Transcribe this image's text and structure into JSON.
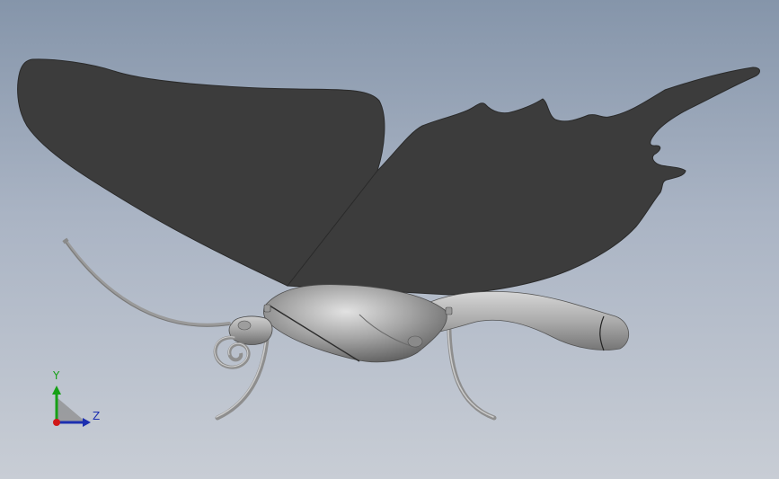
{
  "viewport": {
    "background_top": "#8595aa",
    "background_bottom": "#c8cdd5"
  },
  "model": {
    "subject": "butterfly-3d-model",
    "wing_color": "#3c3c3c",
    "body_color": "#a8a8a8"
  },
  "triad": {
    "y_label": "Y",
    "z_label": "Z",
    "y_color": "#16a016",
    "z_color": "#1c2fb0",
    "origin_color": "#d01818"
  }
}
